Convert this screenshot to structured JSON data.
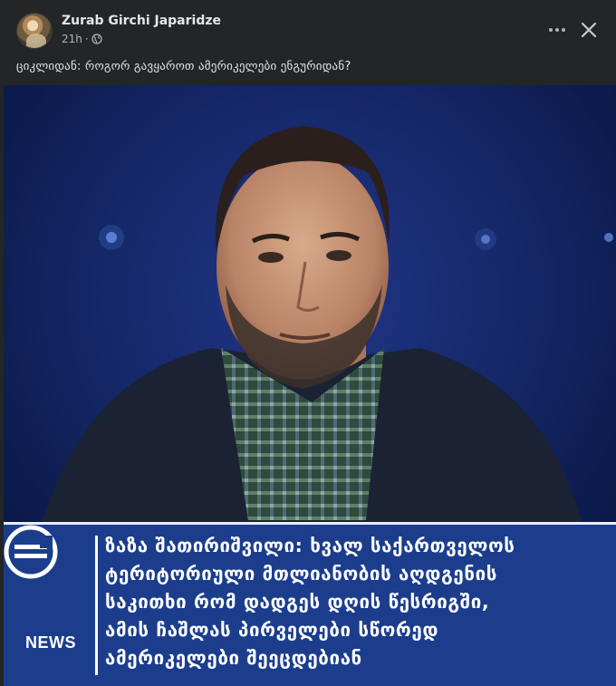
{
  "post": {
    "author": "Zurab Girchi Japaridze",
    "time": "21h",
    "caption": "ციკლიდან: როგორ გავყაროთ ამერიკელები ენგურიდან?",
    "icons": {
      "visibility": "globe-icon",
      "more": "more-options-icon",
      "close": "close-icon"
    }
  },
  "image": {
    "logo_text": "NEWS",
    "headline_lines": [
      "ზაზა შათირიშვილი: ხვალ საქართველოს",
      "ტერიტორიული მთლიანობის აღდგენის",
      "საკითხი რომ დადგეს დღის წესრიგში,",
      "ამის ჩაშლას პირველები სწორედ",
      "ამერიკელები შეეცდებიან"
    ]
  },
  "colors": {
    "background": "#242526",
    "text_primary": "#e4e6eb",
    "text_secondary": "#b0b3b8",
    "news_band": "#1b3d8c"
  }
}
